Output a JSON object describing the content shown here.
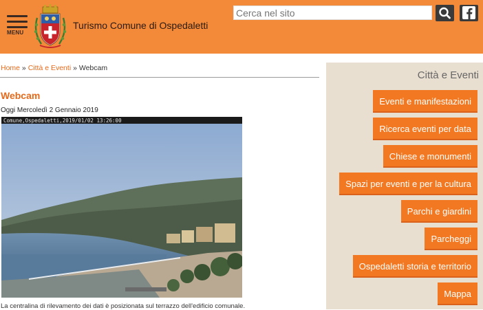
{
  "header": {
    "menu_label": "MENU",
    "site_title": "Turismo Comune di Ospedaletti",
    "search_placeholder": "Cerca nel sito",
    "search_icon": "search-icon",
    "facebook_icon": "facebook-icon"
  },
  "breadcrumb": {
    "home": "Home",
    "sep1": " » ",
    "section": "Città e Eventi",
    "sep2": " » ",
    "current": "Webcam"
  },
  "main": {
    "title": "Webcam",
    "date_line": "Oggi Mercoledì 2 Gennaio 2019",
    "webcam_stamp": "Comune,Ospedaletti,2019/01/02 13:26:00",
    "caption": "La centralina di rilevamento dei dati è posizionata sul terrazzo dell'edificio comunale."
  },
  "sidebar": {
    "title": "Città e Eventi",
    "items": [
      {
        "label": "Eventi e manifestazioni"
      },
      {
        "label": "Ricerca eventi per data"
      },
      {
        "label": "Chiese e monumenti"
      },
      {
        "label": "Spazi per eventi e per la cultura"
      },
      {
        "label": "Parchi e giardini"
      },
      {
        "label": "Parcheggi"
      },
      {
        "label": "Ospedaletti storia e territorio"
      },
      {
        "label": "Mappa"
      }
    ]
  },
  "colors": {
    "header": "#f28a3a",
    "accent": "#e8691a",
    "sidebar_bg": "#e9dfd0",
    "button": "#f27922"
  }
}
